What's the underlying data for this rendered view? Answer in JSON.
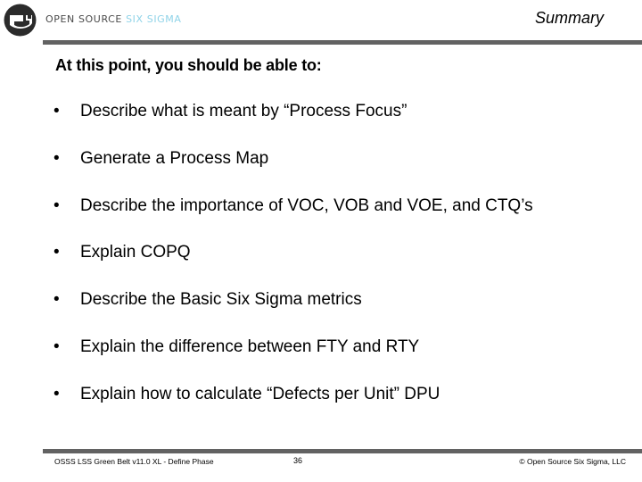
{
  "header": {
    "logo_icon": "open-source-six-sigma-logo",
    "logo_text_main": "OPEN SOURCE ",
    "logo_text_accent": "SIX SIGMA",
    "slide_title": "Summary",
    "colors": {
      "bar": "#626262",
      "logo_accent": "#8fd3e8",
      "logo_dark": "#2b2b2b"
    }
  },
  "content": {
    "subtitle": "At this point, you should be able to:",
    "bullet_glyph": "•",
    "bullets": [
      "Describe what is meant by “Process Focus”",
      "Generate a Process Map",
      "Describe the importance of VOC, VOB and VOE, and CTQ’s",
      "Explain COPQ",
      "Describe the Basic Six Sigma metrics",
      "Explain the difference between FTY and RTY",
      "Explain how to calculate “Defects per Unit” DPU"
    ]
  },
  "footer": {
    "left": "OSSS LSS Green Belt v11.0 XL - Define Phase",
    "page_number": "36",
    "right": "© Open Source Six Sigma, LLC"
  }
}
